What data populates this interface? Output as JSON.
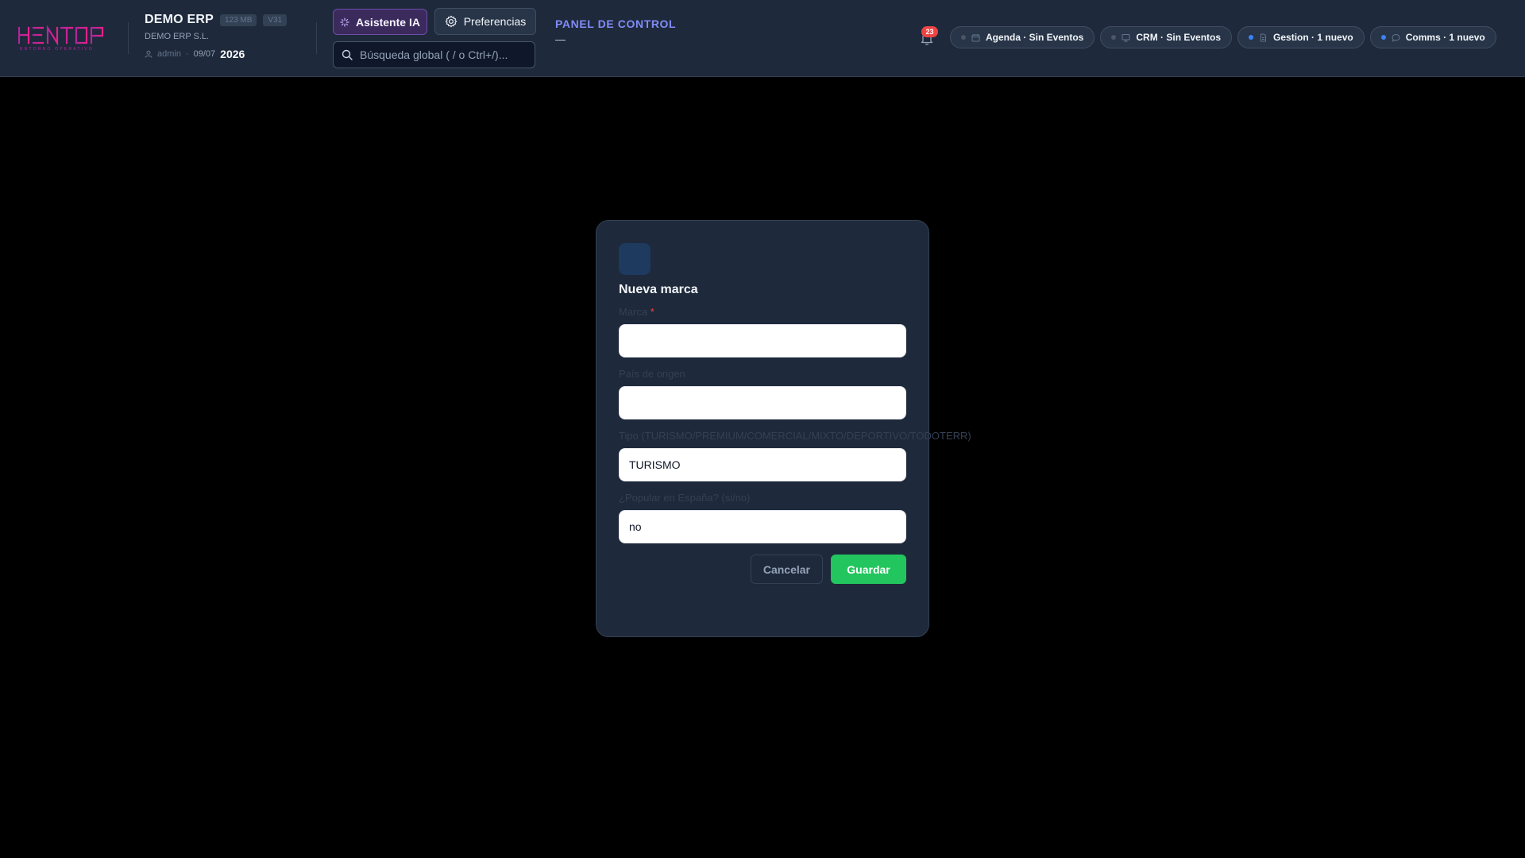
{
  "brand": {
    "logo_text": "HENTOP",
    "tagline": "ENTORNO OPERATIVO"
  },
  "company": {
    "name": "DEMO ERP",
    "storage_badge": "123 MB",
    "version_badge": "V31",
    "legal_name": "DEMO ERP S.L.",
    "user": "admin",
    "date": "09/07",
    "year": "2026"
  },
  "toolbar": {
    "ai_label": "Asistente IA",
    "prefs_label": "Preferencias",
    "search_placeholder": "Búsqueda global ( / o Ctrl+/)..."
  },
  "header": {
    "panel_title": "PANEL DE CONTROL",
    "panel_sub": "—"
  },
  "notifications": {
    "count": "23"
  },
  "status_pills": [
    {
      "dot": "grey",
      "icon": "calendar-icon",
      "label": "Agenda · Sin Eventos"
    },
    {
      "dot": "grey",
      "icon": "monitor-icon",
      "label": "CRM · Sin Eventos"
    },
    {
      "dot": "blue",
      "icon": "document-icon",
      "label": "Gestion · 1 nuevo"
    },
    {
      "dot": "blue",
      "icon": "chat-icon",
      "label": "Comms · 1 nuevo"
    }
  ],
  "modal": {
    "title": "Nueva marca",
    "fields": [
      {
        "label": "Marca",
        "required_mark": "*",
        "value": ""
      },
      {
        "label": "País de origen",
        "value": ""
      },
      {
        "label": "Tipo (TURISMO/PREMIUM/COMERCIAL/MIXTO/DEPORTIVO/TODOTERR)",
        "value": "TURISMO"
      },
      {
        "label": "¿Popular en España? (si/no)",
        "value": "no"
      }
    ],
    "cancel_label": "Cancelar",
    "save_label": "Guardar"
  },
  "colors": {
    "topbar_bg": "#1e293b",
    "accent_indigo": "#818cf8",
    "brand_magenta": "#d62aa0",
    "save_green": "#22c55e",
    "badge_red": "#ef4444"
  }
}
